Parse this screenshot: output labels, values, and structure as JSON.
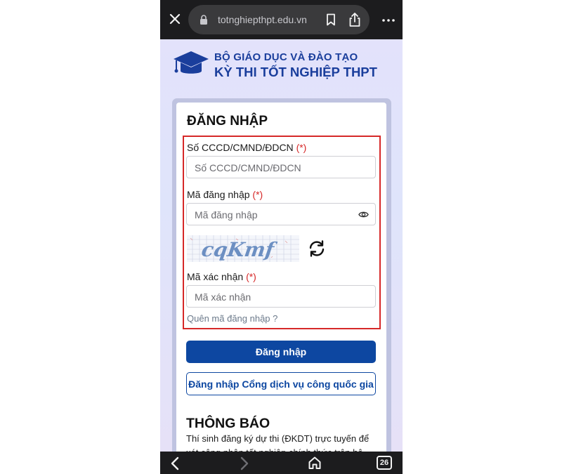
{
  "browser": {
    "url": "totnghiepthpt.edu.vn",
    "tab_count": "26"
  },
  "header": {
    "org_name": "BỘ GIÁO DỤC VÀ ĐÀO TẠO",
    "exam_name": "KỲ THI TỐT NGHIỆP THPT"
  },
  "login": {
    "title": "ĐĂNG NHẬP",
    "id_label": "Số CCCD/CMND/ĐDCN",
    "id_placeholder": "Số CCCD/CMND/ĐDCN",
    "password_label": "Mã đăng nhập",
    "password_placeholder": "Mã đăng nhập",
    "captcha_text": "cqKmf",
    "captcha_label": "Mã xác nhận",
    "captcha_placeholder": "Mã xác nhận",
    "required_mark": "(*)",
    "forgot_link": "Quên mã đăng nhập ?",
    "login_button": "Đăng nhập",
    "national_portal_button": "Đăng nhập Cổng dịch vụ công quốc gia"
  },
  "notice": {
    "title": "THÔNG BÁO",
    "text": "Thí sinh đăng ký dự thi (ĐKDT) trực tuyến để xét công nhận tốt nghiệp chính thức trên hệ"
  },
  "colors": {
    "brand": "#1a3e9c",
    "primary_button": "#0d47a1",
    "required": "#d62828",
    "highlight_box": "#d62828"
  },
  "icons": [
    "close-icon",
    "lock-icon",
    "bookmark-icon",
    "share-icon",
    "more-icon",
    "eye-icon",
    "refresh-icon",
    "back-icon",
    "forward-icon",
    "home-icon",
    "tabs-icon"
  ]
}
